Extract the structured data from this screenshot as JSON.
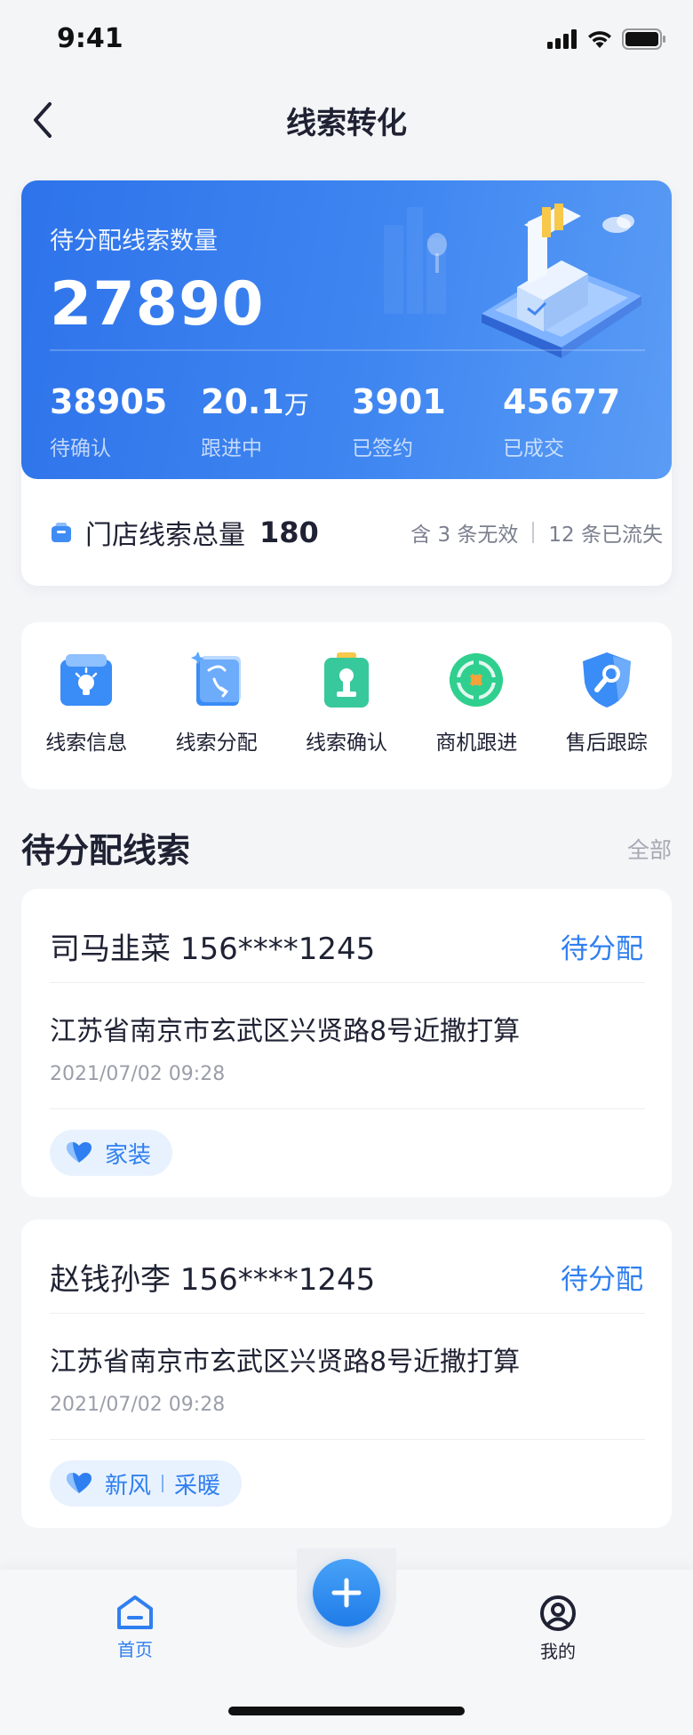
{
  "status": {
    "time": "9:41"
  },
  "nav": {
    "title": "线索转化"
  },
  "hero": {
    "label": "待分配线索数量",
    "count": "27890",
    "stats": [
      {
        "value": "38905",
        "unit": "",
        "label": "待确认"
      },
      {
        "value": "20.1",
        "unit": "万",
        "label": "跟进中"
      },
      {
        "value": "3901",
        "unit": "",
        "label": "已签约"
      },
      {
        "value": "45677",
        "unit": "",
        "label": "已成交"
      }
    ]
  },
  "store": {
    "label": "门店线索总量",
    "total": "180",
    "note_invalid": "含 3 条无效",
    "note_lost": "12 条已流失"
  },
  "actions": [
    {
      "label": "线索信息",
      "icon": "lead-info-icon"
    },
    {
      "label": "线索分配",
      "icon": "lead-assign-icon"
    },
    {
      "label": "线索确认",
      "icon": "lead-confirm-icon"
    },
    {
      "label": "商机跟进",
      "icon": "opportunity-icon"
    },
    {
      "label": "售后跟踪",
      "icon": "after-sales-icon"
    }
  ],
  "section": {
    "title": "待分配线索",
    "more": "全部"
  },
  "leads": [
    {
      "name": "司马韭菜 156****1245",
      "status": "待分配",
      "address": "江苏省南京市玄武区兴贤路8号近撒打算",
      "time": "2021/07/02 09:28",
      "tags": [
        "家装"
      ]
    },
    {
      "name": "赵钱孙李 156****1245",
      "status": "待分配",
      "address": "江苏省南京市玄武区兴贤路8号近撒打算",
      "time": "2021/07/02 09:28",
      "tags": [
        "新风",
        "采暖"
      ]
    }
  ],
  "tabbar": {
    "home": "首页",
    "mine": "我的"
  },
  "colors": {
    "primary": "#2f7ff0",
    "hero_start": "#2e73ea",
    "hero_end": "#5a9cf5"
  }
}
